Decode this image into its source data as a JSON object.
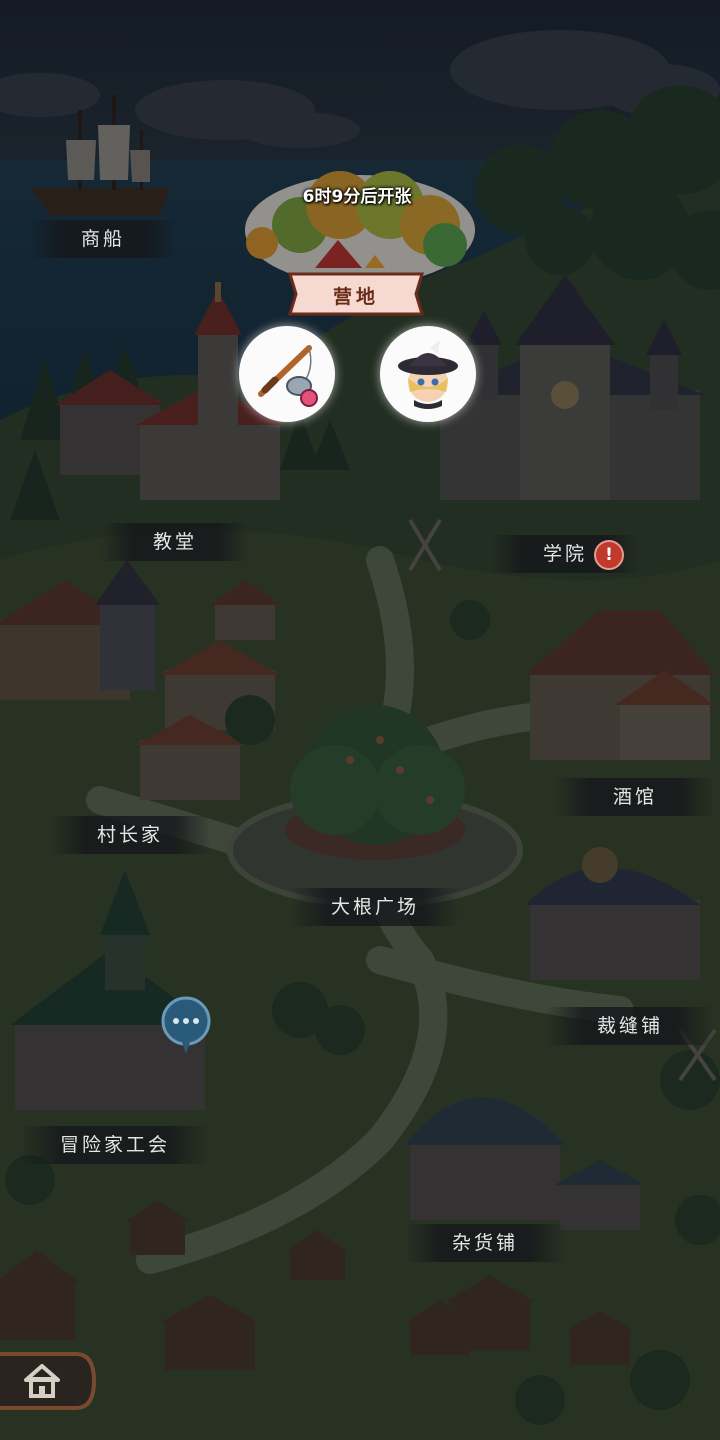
{
  "places": {
    "merchant_ship": "商船",
    "church": "教堂",
    "academy": "学院",
    "tavern": "酒馆",
    "village_chief_home": "村长家",
    "big_root_square": "大根广场",
    "tailor_shop": "裁缝铺",
    "adventurer_guild": "冒险家工会",
    "general_store": "杂货铺"
  },
  "camp": {
    "timer": "6时9分后开张",
    "label": "营地"
  },
  "icons": {
    "academy_alert": "!",
    "fishing_bubble": "fishing-rod-icon",
    "character_bubble": "character-portrait-icon",
    "chat_bubble": "chat-ellipsis-icon",
    "home_button": "home-icon"
  },
  "colors": {
    "night_sky": "#1b2530",
    "alert_red": "#c0392b",
    "ribbon_pink": "#f6d9d0",
    "label_text": "#e6e6e6"
  }
}
